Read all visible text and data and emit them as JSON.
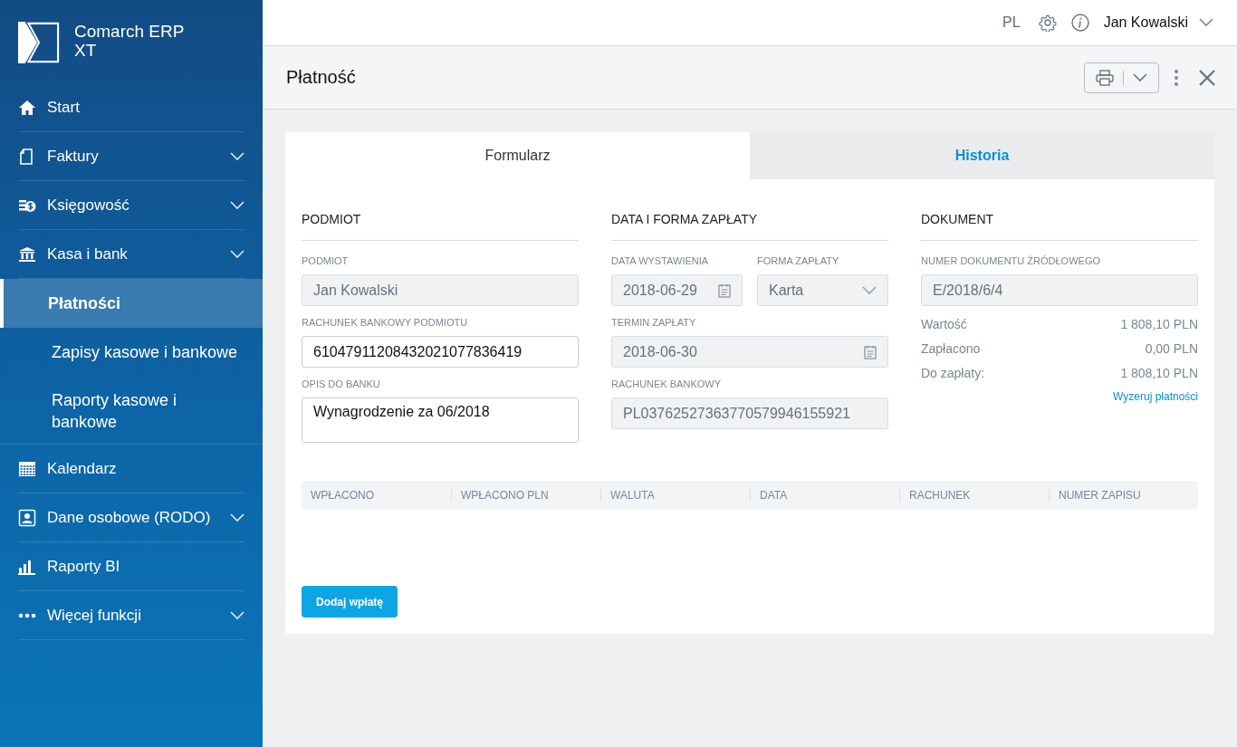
{
  "sidebar": {
    "logo": {
      "line1": "Comarch ERP",
      "line2": "XT"
    },
    "items": [
      {
        "label": "Start",
        "expandable": false,
        "expanded": false
      },
      {
        "label": "Faktury",
        "expandable": true,
        "expanded": false
      },
      {
        "label": "Księgowość",
        "expandable": true,
        "expanded": false
      },
      {
        "label": "Kasa i bank",
        "expandable": true,
        "expanded": true,
        "children": [
          {
            "label": "Płatności",
            "selected": true
          },
          {
            "label": "Zapisy kasowe i bankowe",
            "selected": false
          },
          {
            "label": "Raporty kasowe i bankowe",
            "selected": false
          }
        ]
      },
      {
        "label": "Kalendarz",
        "expandable": false,
        "expanded": false
      },
      {
        "label": "Dane osobowe (RODO)",
        "expandable": true,
        "expanded": false
      },
      {
        "label": "Raporty BI",
        "expandable": false,
        "expanded": false
      },
      {
        "label": "Więcej funkcji",
        "expandable": true,
        "expanded": false
      }
    ]
  },
  "topbar": {
    "language": "PL",
    "user": "Jan Kowalski"
  },
  "page": {
    "title": "Płatność"
  },
  "tabs": [
    {
      "label": "Formularz",
      "selected": true
    },
    {
      "label": "Historia",
      "selected": false
    }
  ],
  "sections": [
    {
      "title": "PODMIOT",
      "rows": [
        [
          {
            "label": "PODMIOT",
            "kind": "text",
            "value": "Jan Kowalski",
            "disabled": true
          }
        ],
        [
          {
            "label": "RACHUNEK BANKOWY PODMIOTU",
            "kind": "text",
            "value": "61047911208432021077836419",
            "disabled": false
          }
        ],
        [
          {
            "label": "OPIS DO BANKU",
            "kind": "textarea",
            "value": "Wynagrodzenie za 06/2018",
            "disabled": false
          }
        ]
      ]
    },
    {
      "title": "DATA I FORMA ZAPŁATY",
      "rows": [
        [
          {
            "label": "DATA WYSTAWIENIA",
            "kind": "date",
            "value": "2018-06-29",
            "disabled": true
          },
          {
            "label": "FORMA ZAPŁATY",
            "kind": "select",
            "value": "Karta",
            "disabled": true
          }
        ],
        [
          {
            "label": "TERMIN ZAPŁATY",
            "kind": "date",
            "value": "2018-06-30",
            "disabled": true
          }
        ],
        [
          {
            "label": "RACHUNEK BANKOWY",
            "kind": "text",
            "value": "PL03762527363770579946155921",
            "disabled": true
          }
        ]
      ]
    },
    {
      "title": "DOKUMENT",
      "rows": [
        [
          {
            "label": "NUMER DOKUMENTU ŹRÓDŁOWEGO",
            "kind": "text",
            "value": "E/2018/6/4",
            "disabled": true
          }
        ]
      ],
      "summary": [
        {
          "label": "Wartość",
          "value": "1 808,10 PLN"
        },
        {
          "label": "Zapłacono",
          "value": "0,00 PLN"
        },
        {
          "label": "Do zapłaty:",
          "value": "1 808,10 PLN"
        }
      ],
      "link": "Wyzeruj płatności"
    }
  ],
  "table": {
    "columns": [
      "WPŁACONO",
      "WPŁACONO PLN",
      "WALUTA",
      "DATA",
      "RACHUNEK",
      "NUMER ZAPISU"
    ]
  },
  "add_button": "Dodaj wpłatę"
}
